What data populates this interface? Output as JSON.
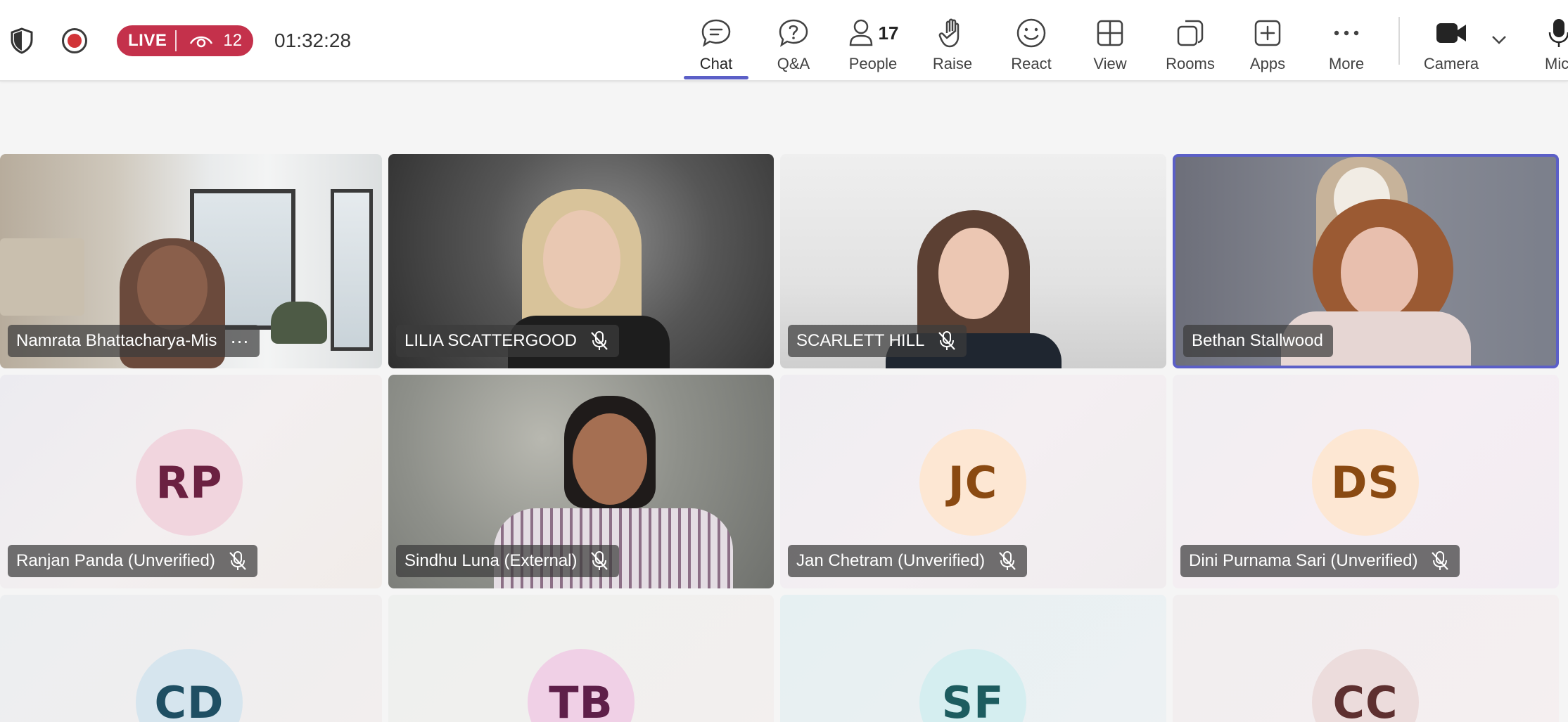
{
  "topbar": {
    "live_label": "LIVE",
    "view_count": "12",
    "timer": "01:32:28",
    "tools": [
      {
        "label": "Chat",
        "icon": "chat-icon"
      },
      {
        "label": "Q&A",
        "icon": "qa-icon"
      },
      {
        "label": "People",
        "icon": "people-icon",
        "count": "17"
      },
      {
        "label": "Raise",
        "icon": "hand-icon"
      },
      {
        "label": "React",
        "icon": "smiley-icon"
      },
      {
        "label": "View",
        "icon": "grid-icon"
      },
      {
        "label": "Rooms",
        "icon": "rooms-icon"
      },
      {
        "label": "Apps",
        "icon": "plus-square-icon"
      },
      {
        "label": "More",
        "icon": "ellipsis-icon"
      },
      {
        "label": "Camera",
        "icon": "camera-icon"
      },
      {
        "label": "Mic",
        "icon": "mic-icon"
      }
    ],
    "active_tool": "Chat"
  },
  "participants": [
    {
      "name": "Namrata Bhattacharya-Mis",
      "type": "video",
      "muted": false,
      "has_menu": true
    },
    {
      "name": "LILIA SCATTERGOOD",
      "type": "video",
      "muted": true
    },
    {
      "name": "SCARLETT HILL",
      "type": "video",
      "muted": true
    },
    {
      "name": "Bethan Stallwood",
      "type": "video",
      "muted": false,
      "speaking": true
    },
    {
      "name": "Ranjan Panda (Unverified)",
      "type": "avatar",
      "initials": "RP",
      "muted": true
    },
    {
      "name": "Sindhu Luna (External)",
      "type": "video",
      "muted": true
    },
    {
      "name": "Jan Chetram (Unverified)",
      "type": "avatar",
      "initials": "JC",
      "muted": true
    },
    {
      "name": "Dini Purnama Sari (Unverified)",
      "type": "avatar",
      "initials": "DS",
      "muted": true
    },
    {
      "initials": "CD",
      "type": "avatar"
    },
    {
      "initials": "TB",
      "type": "avatar"
    },
    {
      "initials": "SF",
      "type": "avatar"
    },
    {
      "initials": "CC",
      "type": "avatar"
    }
  ],
  "colors": {
    "accent": "#5b5fc7",
    "live": "#c4314b",
    "recording": "#d13438"
  }
}
